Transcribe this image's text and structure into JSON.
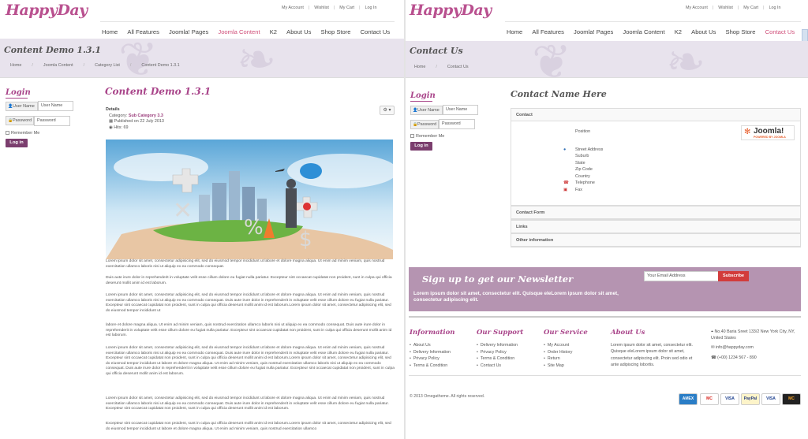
{
  "left": {
    "logo": "HappyDay",
    "top_links": [
      "My Account",
      "Wishlist",
      "My Cart",
      "Log In"
    ],
    "nav": [
      "Home",
      "All Features",
      "Joomla! Pages",
      "Joomla Content",
      "K2",
      "About Us",
      "Shop Store",
      "Contact Us"
    ],
    "nav_active": "Joomla Content",
    "banner_title": "Content Demo 1.3.1",
    "breadcrumbs": [
      "Home",
      "Joomla Content",
      "Category List",
      "Content Demo 1.3.1"
    ],
    "login": {
      "title": "Login",
      "username_label": "User Name",
      "username_placeholder": "User Name",
      "password_label": "Password",
      "password_placeholder": "Password",
      "remember": "Remember Me",
      "button": "Log in"
    },
    "article": {
      "title": "Content Demo 1.3.1",
      "details_label": "Details",
      "category_prefix": "Category:",
      "category": "Sub Category 3.3",
      "published": "Published on 22 July 2013",
      "hits": "Hits: 69",
      "tools_icon": "gear-icon",
      "paragraphs": [
        "Lorem ipsum dolor sit amet, consectetur adipisicing elit, sed do eiusmod tempor incididunt ut labore et dolore magna aliqua. Ut enim ad minim veniam, quis nostrud exercitation ullamco laboris nisi ut aliquip ex ea commodo consequat.",
        "Duis aute irure dolor in reprehenderit in voluptate velit esse cillum dolore eu fugiat nulla pariatur. Excepteur sint occaecat cupidatat non proident, sunt in culpa qui officia deserunt mollit anim id est laborum.",
        "Lorem ipsum dolor sit amet, consectetur adipisicing elit, sed do eiusmod tempor incididunt ut labore et dolore magna aliqua. Ut enim ad minim veniam, quis nostrud exercitation ullamco laboris nisi ut aliquip ex ea commodo consequat. Duis aute irure dolor in reprehenderit in voluptate velit esse cillum dolore eu fugiat nulla pariatur. Excepteur sint occaecat cupidatat non proident, sunt in culpa qui officia deserunt mollit anim id est laborum.Lorem ipsum dolor sit amet, consectetur adipisicing elit, sed do eiusmod tempor incididunt ut",
        "labore et dolore magna aliqua. Ut enim ad minim veniam, quis nostrud exercitation ullamco laboris nisi ut aliquip ex ea commodo consequat. Duis aute irure dolor in reprehenderit in voluptate velit esse cillum dolore eu fugiat nulla pariatur. Excepteur sint occaecat cupidatat non proident, sunt in culpa qui officia deserunt mollit anim id est laborum.",
        "Lorem ipsum dolor sit amet, consectetur adipisicing elit, sed do eiusmod tempor incididunt ut labore et dolore magna aliqua. Ut enim ad minim veniam, quis nostrud exercitation ullamco laboris nisi ut aliquip ex ea commodo consequat. Duis aute irure dolor in reprehenderit in voluptate velit esse cillum dolore eu fugiat nulla pariatur. Excepteur sint occaecat cupidatat non proident, sunt in culpa qui officia deserunt mollit anim id est laborum.Lorem ipsum dolor sit amet, consectetur adipisicing elit, sed do eiusmod tempor incididunt ut labore et dolore magna aliqua. Ut enim ad minim veniam, quis nostrud exercitation ullamco laboris nisi ut aliquip ex ea commodo consequat. Duis aute irure dolor in reprehenderit in voluptate velit esse cillum dolore eu fugiat nulla pariatur. Excepteur sint occaecat cupidatat non proident, sunt in culpa qui officia deserunt mollit anim id est laborum.",
        "Lorem ipsum dolor sit amet, consectetur adipisicing elit, sed do eiusmod tempor incididunt ut labore et dolore magna aliqua. Ut enim ad minim veniam, quis nostrud exercitation ullamco laboris nisi ut aliquip ex ea commodo consequat. Duis aute irure dolor in reprehenderit in voluptate velit esse cillum dolore eu fugiat nulla pariatur. Excepteur sint occaecat cupidatat non proident, sunt in culpa qui officia deserunt mollit anim id est laborum.",
        "Excepteur sint occaecat cupidatat non proident, sunt in culpa qui officia deserunt mollit anim id est laborum.Lorem ipsum dolor sit amet, consectetur adipisicing elit, sed do eiusmod tempor incididunt ut labore et dolore magna aliqua. Ut enim ad minim veniam, quis nostrud exercitation ullamco"
      ]
    }
  },
  "right": {
    "logo": "HappyDay",
    "top_links": [
      "My Account",
      "Wishlist",
      "My Cart",
      "Log In"
    ],
    "nav": [
      "Home",
      "All Features",
      "Joomla! Pages",
      "Joomla Content",
      "K2",
      "About Us",
      "Shop Store",
      "Contact Us"
    ],
    "nav_active": "Contact Us",
    "banner_title": "Contact Us",
    "breadcrumbs": [
      "Home",
      "Contact Us"
    ],
    "login": {
      "title": "Login",
      "username_label": "User Name",
      "username_placeholder": "User Name",
      "password_label": "Password",
      "password_placeholder": "Password",
      "remember": "Remember Me",
      "button": "Log in"
    },
    "contact": {
      "title": "Contact Name Here",
      "sections": [
        "Contact",
        "Contact Form",
        "Links",
        "Other information"
      ],
      "position": "Position",
      "fields": [
        "Street Address",
        "Suburb",
        "State",
        "Zip Code",
        "Country",
        "Telephone",
        "Fax"
      ],
      "joomla_logo_text": "Joomla!",
      "joomla_logo_sub": "POWERED BY JOOMLA"
    },
    "newsletter": {
      "title": "Sign up to get our Newsletter",
      "text": "Lorem ipsum dolor sit amet, consectetur elit. Quisque eleLorem ipsum dolor sit amet, consectetur adipiscing elit.",
      "email_placeholder": "Your Email Address",
      "button": "Subscribe"
    },
    "footer": {
      "columns": [
        {
          "title": "Information",
          "items": [
            "About Us",
            "Delivery Information",
            "Privacy Policy",
            "Terms & Condition"
          ]
        },
        {
          "title": "Our Support",
          "items": [
            "Delivery Information",
            "Privacy Policy",
            "Terms & Condition",
            "Contact Us"
          ]
        },
        {
          "title": "Our Service",
          "items": [
            "My Account",
            "Order History",
            "Return",
            "Site Map"
          ]
        }
      ],
      "about_title": "About Us",
      "about_text": "Lorem ipsum dolor sit amet, consectetur elit. Quisque eleLorem ipsum dolor sit amet, consectetur adipiscing elit. Proin sed odio et ante adipiscing lobortis.",
      "address": "No.40 Baria Sreet 133/2 New York City, NY, United States",
      "email": "info@happyday.com",
      "phone": "(+00) 1234 567 - 890",
      "copyright": "© 2013 Omegatheme. All rights reserved.",
      "cards": [
        "AMEX",
        "MC",
        "VISA",
        "PayPal",
        "VISA",
        "MC"
      ]
    }
  }
}
